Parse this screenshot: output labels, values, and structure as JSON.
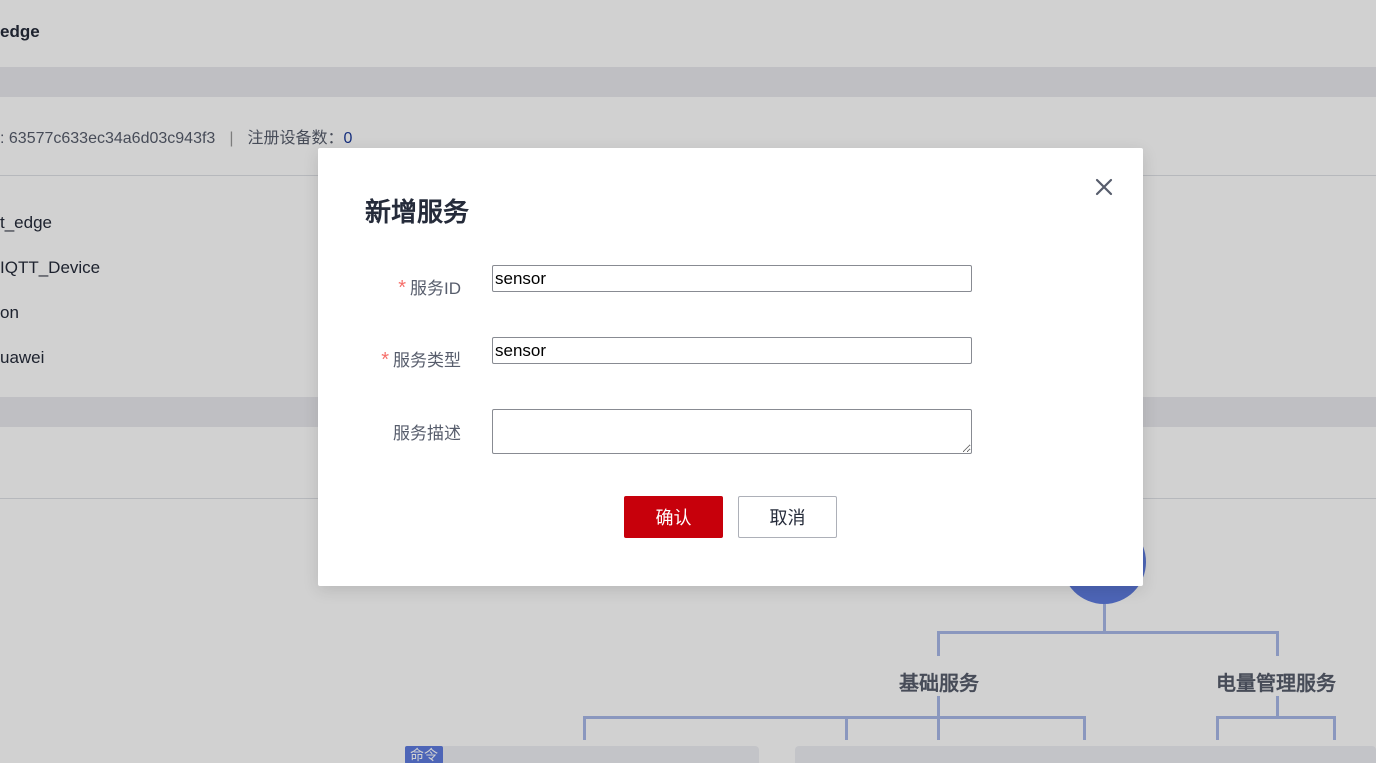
{
  "background": {
    "title": "edge",
    "meta": {
      "id_label": ": 63577c633ec34a6d03c943f3",
      "separator": "|",
      "registered_label": "注册设备数：",
      "registered_count": "0"
    },
    "rows": [
      "t_edge",
      "IQTT_Device",
      "on",
      "uawei"
    ],
    "tree": {
      "node_basic": "基础服务",
      "node_power": "电量管理服务",
      "cmd_tag": "命令"
    }
  },
  "modal": {
    "title": "新增服务",
    "fields": {
      "service_id": {
        "label": "服务ID",
        "value": "sensor"
      },
      "service_type": {
        "label": "服务类型",
        "value": "sensor"
      },
      "service_desc": {
        "label": "服务描述",
        "value": ""
      }
    },
    "required_mark": "*",
    "confirm_label": "确认",
    "cancel_label": "取消",
    "close_icon": "close-icon"
  },
  "colors": {
    "primary_button": "#c7000b",
    "required_star": "#f66f6a",
    "tree_circle": "#5e7ce0"
  }
}
